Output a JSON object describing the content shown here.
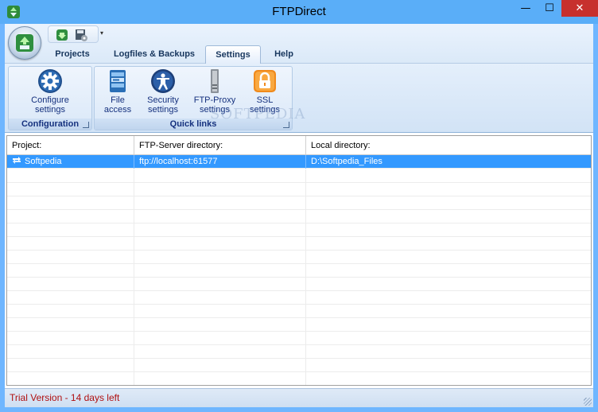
{
  "window": {
    "title": "FTPDirect",
    "minimize_label": "—",
    "maximize_label": "☐",
    "close_label": "✕"
  },
  "ribbon": {
    "tabs": [
      {
        "label": "Projects"
      },
      {
        "label": "Logfiles & Backups"
      },
      {
        "label": "Settings"
      },
      {
        "label": "Help"
      }
    ],
    "active_tab": "Settings",
    "groups": {
      "configuration": {
        "label": "Configuration",
        "buttons": [
          {
            "label_line1": "Configure",
            "label_line2": "settings",
            "icon": "gear-icon"
          }
        ]
      },
      "quick_links": {
        "label": "Quick links",
        "buttons": [
          {
            "label_line1": "File",
            "label_line2": "access",
            "icon": "file-server-icon"
          },
          {
            "label_line1": "Security",
            "label_line2": "settings",
            "icon": "security-person-icon"
          },
          {
            "label_line1": "FTP-Proxy",
            "label_line2": "settings",
            "icon": "proxy-tower-icon"
          },
          {
            "label_line1": "SSL",
            "label_line2": "settings",
            "icon": "lock-icon"
          }
        ]
      }
    },
    "qat_arrow": "▾"
  },
  "watermark": "SOFTPEDIA",
  "grid": {
    "columns": [
      "Project:",
      "FTP-Server directory:",
      "Local directory:"
    ],
    "rows": [
      {
        "project": "Softpedia",
        "server": "ftp://localhost:61577",
        "local": "D:\\Softpedia_Files",
        "selected": true
      }
    ]
  },
  "status": {
    "text": "Trial Version - 14 days left"
  },
  "colors": {
    "selection": "#3399ff",
    "status_text": "#b01010",
    "close_button": "#c7302d",
    "frame": "#5aaef8"
  }
}
